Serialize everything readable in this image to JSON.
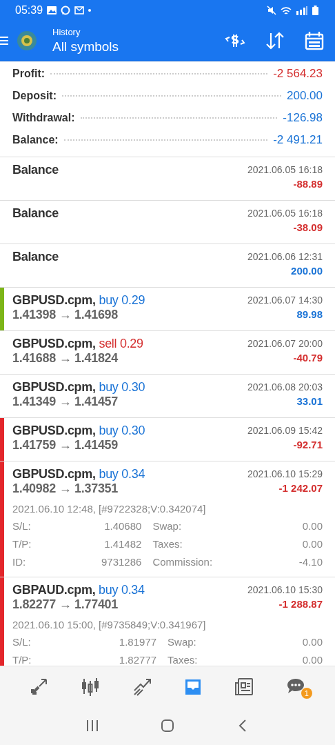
{
  "status_bar": {
    "time": "05:39"
  },
  "toolbar": {
    "subtitle": "History",
    "title": "All symbols"
  },
  "summary": [
    {
      "label": "Profit:",
      "value": {
        "text": "-2 564.23",
        "color": "#d42f2f"
      }
    },
    {
      "label": "Deposit:",
      "value": {
        "text": "200.00",
        "color": "#1a73d6"
      }
    },
    {
      "label": "Withdrawal:",
      "value": {
        "text": "-126.98",
        "color": "#1a73d6"
      }
    },
    {
      "label": "Balance:",
      "value": {
        "text": "-2 491.21",
        "color": "#1a73d6"
      }
    }
  ],
  "entries": [
    {
      "kind": "balance",
      "title": "Balance",
      "time": "2021.06.05 16:18",
      "amount": {
        "text": "-88.89",
        "color": "#d42f2f"
      }
    },
    {
      "kind": "balance",
      "title": "Balance",
      "time": "2021.06.05 16:18",
      "amount": {
        "text": "-38.09",
        "color": "#d42f2f"
      }
    },
    {
      "kind": "balance",
      "title": "Balance",
      "time": "2021.06.06 12:31",
      "amount": {
        "text": "200.00",
        "color": "#1a73d6"
      }
    },
    {
      "kind": "deal",
      "symbol": "GBPUSD.cpm,",
      "side": {
        "text": "buy 0.29",
        "color": "#1a73d6"
      },
      "prices": "1.41398 → 1.41698",
      "time": "2021.06.07 14:30",
      "amount": {
        "text": "89.98",
        "color": "#1a73d6"
      },
      "color": "#7cb518"
    },
    {
      "kind": "deal",
      "symbol": "GBPUSD.cpm,",
      "side": {
        "text": "sell 0.29",
        "color": "#d42f2f"
      },
      "prices": "1.41688 → 1.41824",
      "time": "2021.06.07 20:00",
      "amount": {
        "text": "-40.79",
        "color": "#d42f2f"
      }
    },
    {
      "kind": "deal",
      "symbol": "GBPUSD.cpm,",
      "side": {
        "text": "buy 0.30",
        "color": "#1a73d6"
      },
      "prices": "1.41349 → 1.41457",
      "time": "2021.06.08 20:03",
      "amount": {
        "text": "33.01",
        "color": "#1a73d6"
      }
    },
    {
      "kind": "deal",
      "symbol": "GBPUSD.cpm,",
      "side": {
        "text": "buy 0.30",
        "color": "#1a73d6"
      },
      "prices": "1.41759 → 1.41459",
      "time": "2021.06.09 15:42",
      "amount": {
        "text": "-92.71",
        "color": "#d42f2f"
      },
      "color": "#e3262b"
    },
    {
      "kind": "deal",
      "symbol": "GBPUSD.cpm,",
      "side": {
        "text": "buy 0.34",
        "color": "#1a73d6"
      },
      "prices": "1.40982 → 1.37351",
      "time": "2021.06.10 15:29",
      "amount": {
        "text": "-1 242.07",
        "color": "#d42f2f"
      },
      "color": "#e3262b",
      "expanded": true,
      "open_info": "2021.06.10 12:48, [#9722328;V:0.342074]",
      "details": [
        [
          "S/L:",
          "1.40680",
          "Swap:",
          "0.00"
        ],
        [
          "T/P:",
          "1.41482",
          "Taxes:",
          "0.00"
        ],
        [
          "ID:",
          "9731286",
          "Commission:",
          "-4.10"
        ]
      ]
    },
    {
      "kind": "deal",
      "symbol": "GBPAUD.cpm,",
      "side": {
        "text": "buy 0.34",
        "color": "#1a73d6"
      },
      "prices": "1.82277 → 1.77401",
      "time": "2021.06.10 15:30",
      "amount": {
        "text": "-1 288.87",
        "color": "#d42f2f"
      },
      "color": "#e3262b",
      "expanded": true,
      "open_info": "2021.06.10 15:00, [#9735849;V:0.341967]",
      "details": [
        [
          "S/L:",
          "1.81977",
          "Swap:",
          "0.00"
        ],
        [
          "T/P:",
          "1.82777",
          "Taxes:",
          "0.00"
        ]
      ]
    }
  ],
  "bottom_nav": [
    {
      "selected": false
    },
    {
      "selected": false
    },
    {
      "selected": false
    },
    {
      "selected": true
    },
    {
      "selected": false
    },
    {
      "selected": false,
      "badge": "1"
    }
  ]
}
